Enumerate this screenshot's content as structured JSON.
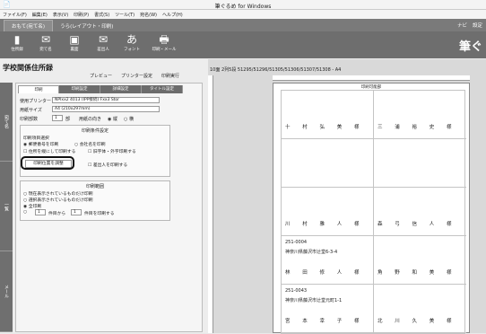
{
  "window": {
    "title": "筆ぐるめ for Windows",
    "app_icon": "📄"
  },
  "menu": [
    "ファイル(F)",
    "編集(E)",
    "表示(V)",
    "印刷(P)",
    "書式(S)",
    "ツール(T)",
    "宛名(W)",
    "ヘルプ(H)"
  ],
  "tabs": [
    {
      "label": "おもて(宛て名)",
      "active": true
    },
    {
      "label": "うら(レイアウト・印刷)",
      "active": false
    }
  ],
  "tabbar_right": {
    "navi": "ナビ",
    "settings": "設定"
  },
  "toolbar": {
    "items": [
      {
        "label": "住所録",
        "glyph": "▮"
      },
      {
        "label": "宛て名",
        "glyph": "✉"
      },
      {
        "label": "裏面",
        "glyph": "▣"
      },
      {
        "label": "差出人",
        "glyph": "✉"
      },
      {
        "label": "フォント",
        "glyph": "あ"
      },
      {
        "label": "印刷・メール",
        "glyph": "🖶"
      }
    ],
    "brand": "筆ぐ"
  },
  "left": {
    "title": "学校関係住所録",
    "preview_bar": [
      "プレビュー",
      "プリンター設定",
      "印刷実行"
    ],
    "vertical_tabs": [
      "宛て名",
      "一覧",
      "メール"
    ],
    "dialog": {
      "tabs": [
        "印刷",
        "印刷設定",
        "詳細設定",
        "タイトル設定"
      ],
      "printer": {
        "label": "使用プリンター",
        "value": "NPIxx2 4013 (IPP接続) Fxx3 Stor"
      },
      "paper": {
        "label": "用紙サイズ",
        "value": "A4 (210x297mm)"
      },
      "copies": {
        "label": "印刷部数",
        "value": "1",
        "unit": "部",
        "orientation_label": "用紙の向き",
        "portrait": "縦",
        "landscape": "横"
      },
      "print_settings": {
        "header": "印刷条件設定",
        "sub": "印刷項目選択",
        "options": [
          "郵便番号を印刷",
          "会社名を印刷",
          "住所を縦にして印刷する",
          "旧字体・外字印刷する"
        ],
        "button": "印刷位置を調整",
        "check": "差出人を印刷する"
      },
      "print_range": {
        "header": "印刷範囲",
        "options": [
          "現在表示されているものだけ印刷",
          "選択表示されているものだけ印刷",
          "全印刷"
        ],
        "from": "1",
        "to": "1",
        "from_label": "件目から",
        "to_label": "件目を印刷する"
      }
    }
  },
  "right": {
    "page_info": "10面 2列5段   51295/51296/51305/51306/51307/51308 - A4",
    "page_header": "印刷可能部",
    "labels": [
      {
        "zip": "",
        "addr": "",
        "name": "十 村 弘 美 様"
      },
      {
        "zip": "",
        "addr": "",
        "name": "三 浦 裕 史 様"
      },
      {
        "zip": "",
        "addr": "",
        "name": ""
      },
      {
        "zip": "",
        "addr": "",
        "name": ""
      },
      {
        "zip": "",
        "addr": "",
        "name": "川 村 雅 人 様"
      },
      {
        "zip": "",
        "addr": "",
        "name": "森 弓 信 人 様"
      },
      {
        "zip": "251-0004",
        "addr": "神奈川県藤沢市辻堂6-3-4",
        "name": "林 田 修 人 様"
      },
      {
        "zip": "",
        "addr": "",
        "name": "角 野 和 美 様"
      },
      {
        "zip": "251-0043",
        "addr": "神奈川県藤沢市辻堂元町1-1",
        "name": "宮 本 幸 子 様"
      },
      {
        "zip": "",
        "addr": "",
        "name": "北 川 久 美 様"
      }
    ]
  }
}
